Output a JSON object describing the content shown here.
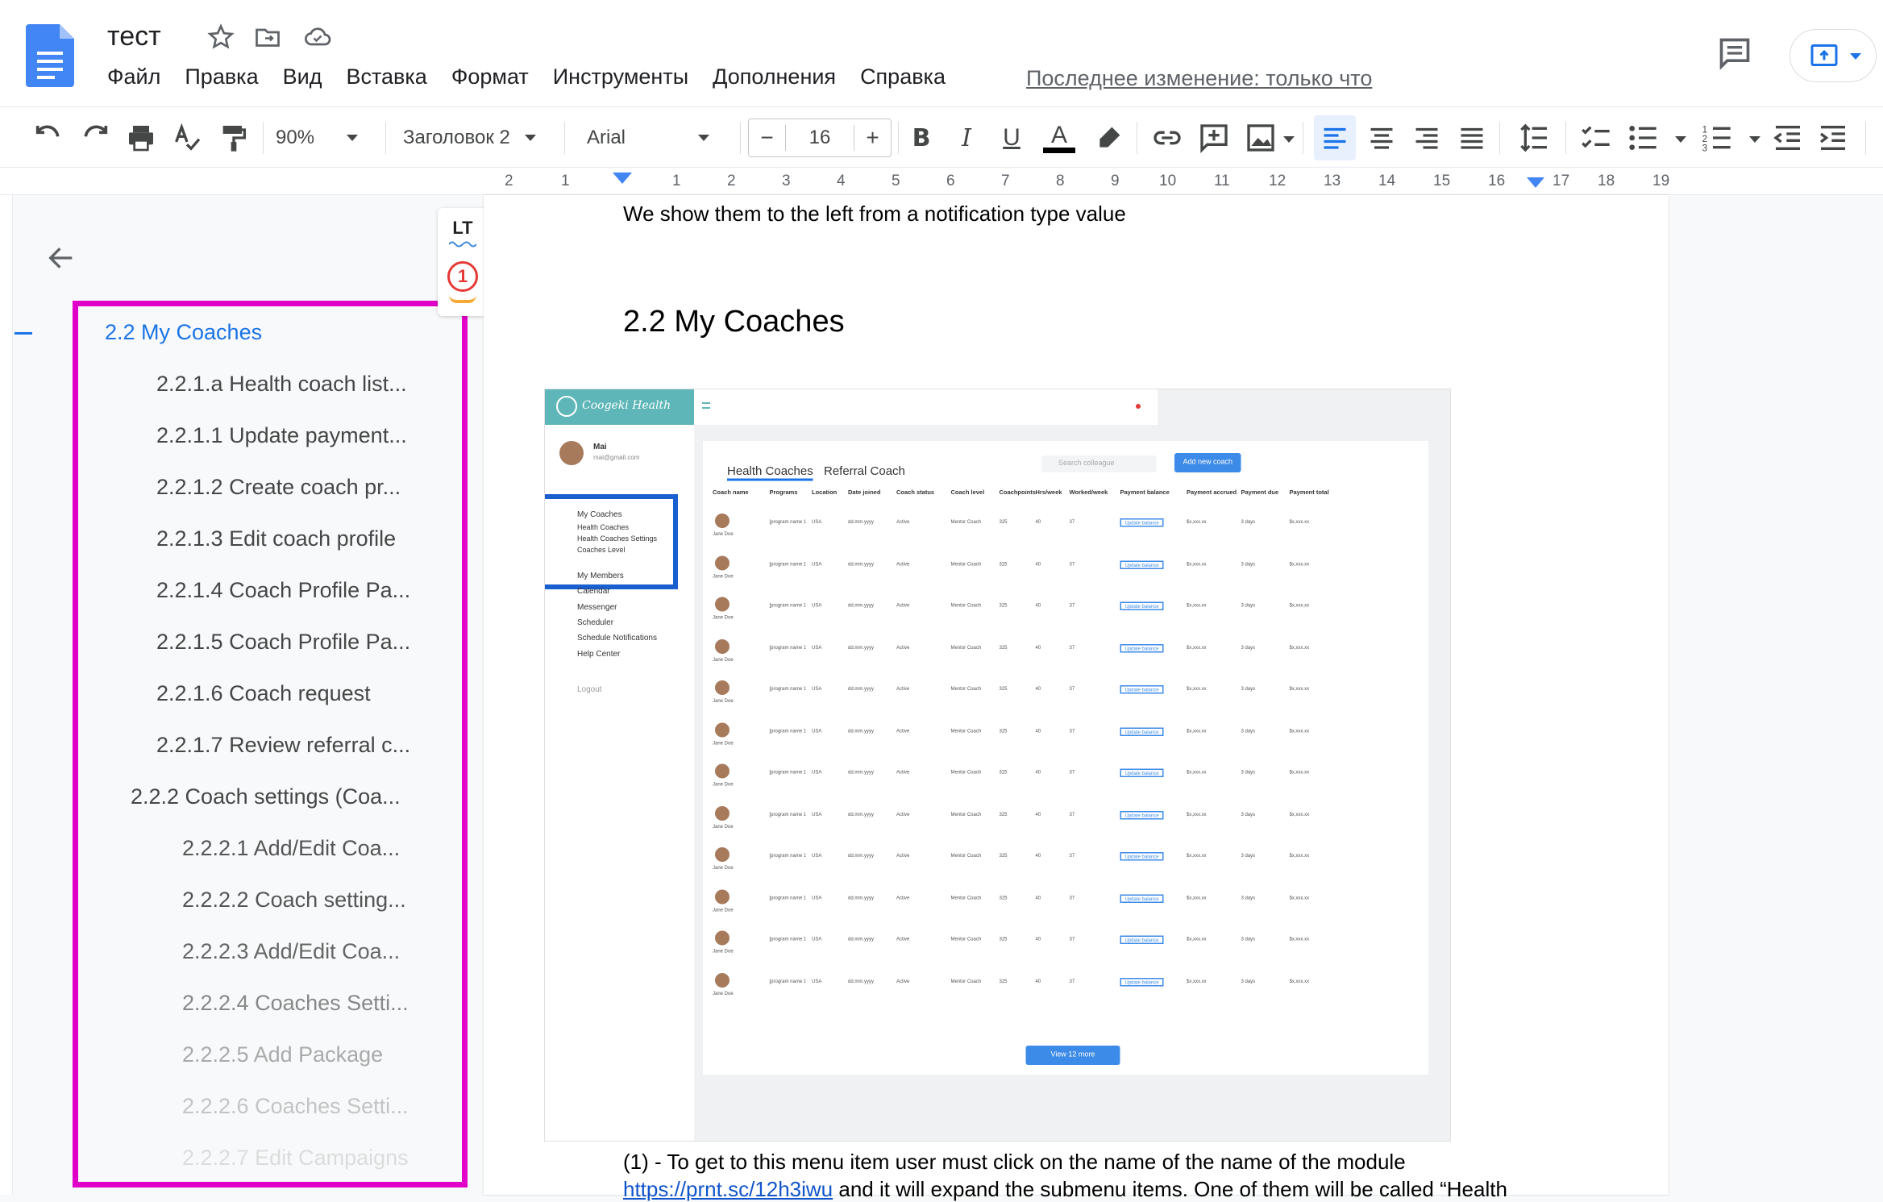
{
  "app": {
    "doc_title": "тест",
    "menu": [
      "Файл",
      "Правка",
      "Вид",
      "Вставка",
      "Формат",
      "Инструменты",
      "Дополнения",
      "Справка"
    ],
    "last_edit": "Последнее изменение: только что"
  },
  "toolbar": {
    "zoom": "90%",
    "style": "Заголовок 2",
    "font": "Arial",
    "font_size": "16",
    "minus": "−",
    "plus": "+",
    "bold": "B",
    "italic": "I",
    "underline": "U",
    "text_color": "A"
  },
  "ruler": {
    "marks": [
      "2",
      "1",
      "1",
      "2",
      "3",
      "4",
      "5",
      "6",
      "7",
      "8",
      "9",
      "10",
      "11",
      "12",
      "13",
      "14",
      "15",
      "16",
      "17",
      "18",
      "19"
    ]
  },
  "outline": {
    "items": [
      {
        "label": "2.2 My Coaches",
        "level": 0,
        "active": true
      },
      {
        "label": "2.2.1.a Health coach list...",
        "level": 2
      },
      {
        "label": "2.2.1.1 Update payment...",
        "level": 2
      },
      {
        "label": "2.2.1.2 Create coach pr...",
        "level": 2
      },
      {
        "label": "2.2.1.3 Edit coach profile",
        "level": 2
      },
      {
        "label": "2.2.1.4 Coach Profile Pa...",
        "level": 2
      },
      {
        "label": "2.2.1.5 Coach Profile Pa...",
        "level": 2
      },
      {
        "label": "2.2.1.6 Coach request",
        "level": 2
      },
      {
        "label": "2.2.1.7 Review referral c...",
        "level": 2
      },
      {
        "label": "2.2.2 Coach settings (Coa...",
        "level": 1
      },
      {
        "label": "2.2.2.1 Add/Edit Coa...",
        "level": 3
      },
      {
        "label": "2.2.2.2 Coach setting...",
        "level": 3
      },
      {
        "label": "2.2.2.3 Add/Edit Coa...",
        "level": 3
      },
      {
        "label": "2.2.2.4 Coaches Setti...",
        "level": 3
      },
      {
        "label": "2.2.2.5 Add Package",
        "level": 3
      },
      {
        "label": "2.2.2.6 Coaches Setti...",
        "level": 3
      },
      {
        "label": "2.2.2.7 Edit Campaigns",
        "level": 3
      }
    ]
  },
  "lt_widget": {
    "label": "LT",
    "badge": "1"
  },
  "document": {
    "line_top": "We show them to the left from a notification type value",
    "heading": "2.2 My Coaches",
    "footer_line1": "(1) - To get to this menu item user must click on the name of the name of the module",
    "footer_link": "https://prnt.sc/12h3iwu",
    "footer_line2_rest": " and it will expand the submenu items. One of them will be called “Health"
  },
  "embedded": {
    "brand": "Coogeki Health",
    "user_name": "Mai",
    "user_email": "mai@gmail.com",
    "sidebar": [
      "My Coaches",
      "Health Coaches",
      "Health Coaches Settings",
      "Coaches Level",
      "My Members",
      "Calendar",
      "Messenger",
      "Scheduler",
      "Schedule Notifications",
      "Help Center",
      "Logout"
    ],
    "tabs": [
      "Health Coaches",
      "Referral Coach"
    ],
    "search_placeholder": "Search colleague",
    "add_button": "Add new coach",
    "columns": [
      "Coach name",
      "Programs",
      "Location",
      "Date joined",
      "Coach status",
      "Coach level",
      "Coachpoints",
      "Hrs/week",
      "Worked/week",
      "Payment balance",
      "Payment accrued",
      "Payment due",
      "Payment total"
    ],
    "row": {
      "name": "Jane Doe",
      "program": "[program name 1], [program...",
      "location": "USA",
      "date": "dd.mm.yyyy",
      "status": "Active",
      "level": "Mentor Coach",
      "points": "325",
      "hrs": "40",
      "worked": "37",
      "action": "Update balance",
      "accrued": "$x,xxx.xx",
      "due": "3 days",
      "total": "$x,xxx.xx"
    },
    "row_count": 12,
    "view_more": "View 12 more"
  },
  "colors": {
    "accent": "#1a73e8",
    "highlight_frame": "#e000c8",
    "embedded_teal": "#5fb6b8"
  }
}
